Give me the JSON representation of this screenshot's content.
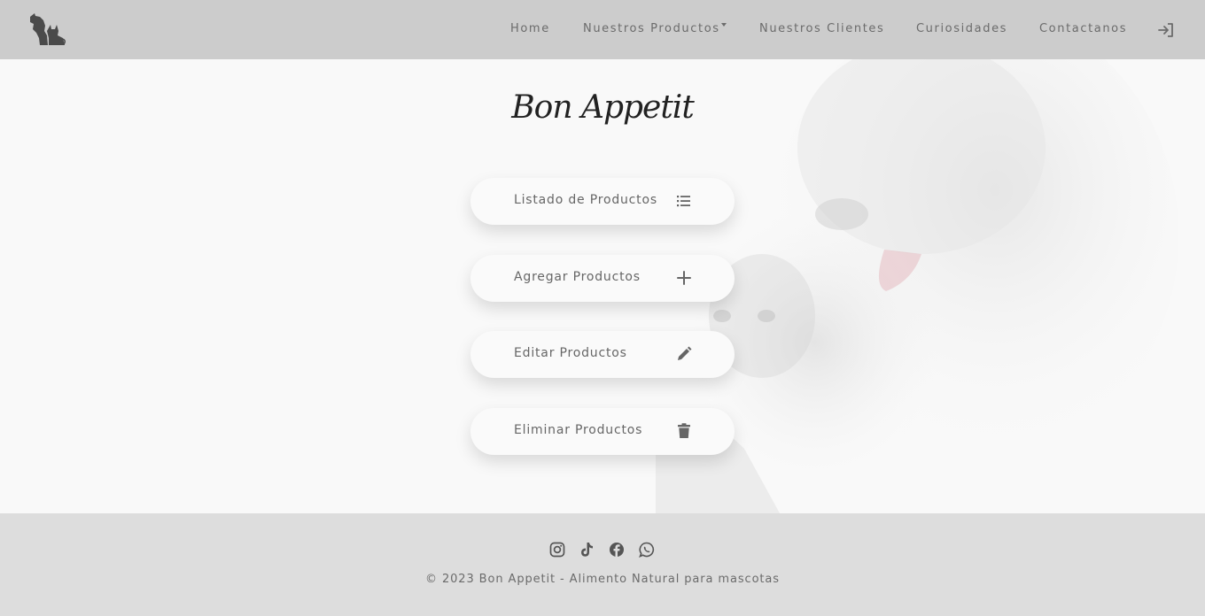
{
  "nav": {
    "home": "Home",
    "productos": "Nuestros Productos",
    "clientes": "Nuestros Clientes",
    "curiosidades": "Curiosidades",
    "contacto": "Contactanos"
  },
  "icons": {
    "logo": "dog-cat-logo-icon",
    "login": "sign-in-icon",
    "list": "list-icon",
    "add": "plus-icon",
    "edit": "pencil-icon",
    "delete": "trash-icon",
    "instagram": "instagram-icon",
    "tiktok": "tiktok-icon",
    "facebook": "facebook-icon",
    "whatsapp": "whatsapp-icon"
  },
  "title": "Bon Appetit",
  "menu": {
    "list_label": "Listado de Productos",
    "add_label": "Agregar Productos",
    "edit_label": "Editar Productos",
    "delete_label": "Eliminar Productos"
  },
  "footer": {
    "copyright": "© 2023 Bon Appetit - Alimento Natural para mascotas"
  },
  "colors": {
    "navbar": "#cccccc",
    "footer": "#dddddd",
    "main_bg": "#f9f9f9",
    "text": "#6b6b6b",
    "title": "#222222"
  }
}
